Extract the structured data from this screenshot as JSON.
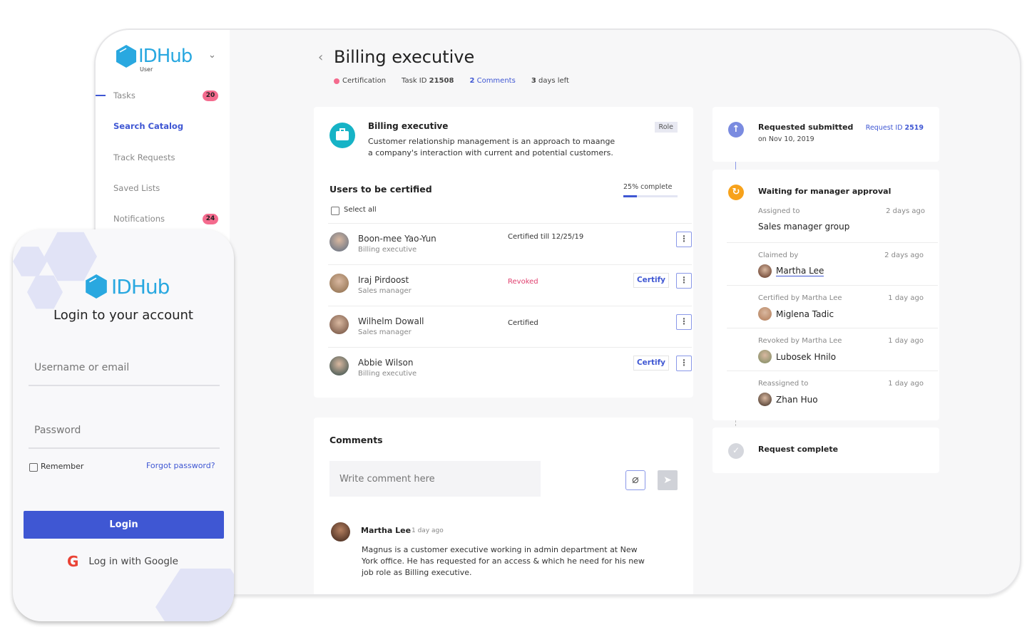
{
  "sidebar": {
    "brand": "IDHub",
    "brand_sub": "User",
    "items": [
      {
        "label": "Tasks",
        "badge": "20"
      },
      {
        "label": "Search Catalog"
      },
      {
        "label": "Track Requests"
      },
      {
        "label": "Saved Lists"
      },
      {
        "label": "Notifications",
        "badge": "24"
      }
    ]
  },
  "header": {
    "title": "Billing executive",
    "type": "Certification",
    "task_id_label": "Task ID",
    "task_id": "21508",
    "comments_count": "2",
    "comments_label": "Comments",
    "days_count": "3",
    "days_label": "days left"
  },
  "role": {
    "title": "Billing executive",
    "badge": "Role",
    "description_1": "Customer relationship management is an approach to maange",
    "description_2": "a company's interaction with current and potential customers."
  },
  "users": {
    "title": "Users to be certified",
    "progress_label": "25% complete",
    "progress": 0.25,
    "select_all": "Select all",
    "certify_label": "Certify",
    "rows": [
      {
        "name": "Boon-mee Yao-Yun",
        "role": "Billing executive",
        "status": "Certified till 12/25/19",
        "certify": false
      },
      {
        "name": "Iraj Pirdoost",
        "role": "Sales manager",
        "status": "Revoked",
        "certify": true
      },
      {
        "name": "Wilhelm Dowall",
        "role": "Sales manager",
        "status": "Certified",
        "certify": false
      },
      {
        "name": "Abbie Wilson",
        "role": "Billing executive",
        "status": "",
        "certify": true
      }
    ]
  },
  "comments": {
    "title": "Comments",
    "placeholder": "Write comment here",
    "items": [
      {
        "author": "Martha Lee",
        "time": "1 day ago",
        "text_1": "Magnus is a customer executive working in admin department at New",
        "text_2": "York office. He has requested for an access & which he need for his new",
        "text_3": "job role as Billing executive."
      }
    ]
  },
  "timeline": {
    "submitted_title": "Requested submitted",
    "submitted_date": "on Nov 10, 2019",
    "request_id_label": "Request ID",
    "request_id": "2519",
    "waiting_title": "Waiting for manager approval",
    "assigned_label": "Assigned to",
    "assigned_time": "2 days ago",
    "assigned_value": "Sales manager group",
    "events": [
      {
        "label": "Claimed by",
        "time": "2 days ago",
        "who": "Martha Lee"
      },
      {
        "label": "Certified by Martha Lee",
        "time": "1 day ago",
        "who": "Miglena Tadic"
      },
      {
        "label": "Revoked by Martha Lee",
        "time": "1 day ago",
        "who": "Lubosek Hnilo"
      },
      {
        "label": "Reassigned to",
        "time": "1 day ago",
        "who": "Zhan Huo"
      }
    ],
    "complete_title": "Request complete"
  },
  "login": {
    "brand": "IDHub",
    "title": "Login to your account",
    "username_placeholder": "Username or email",
    "password_placeholder": "Password",
    "remember": "Remember",
    "forgot": "Forgot password?",
    "login_button": "Login",
    "google": "Log in with Google"
  },
  "colors": {
    "accent": "#3f57d3",
    "badge": "#f46b8e",
    "brand": "#29a8e0",
    "teal": "#16b3c6",
    "orange": "#f7a21b",
    "revoked": "#e0406f"
  }
}
